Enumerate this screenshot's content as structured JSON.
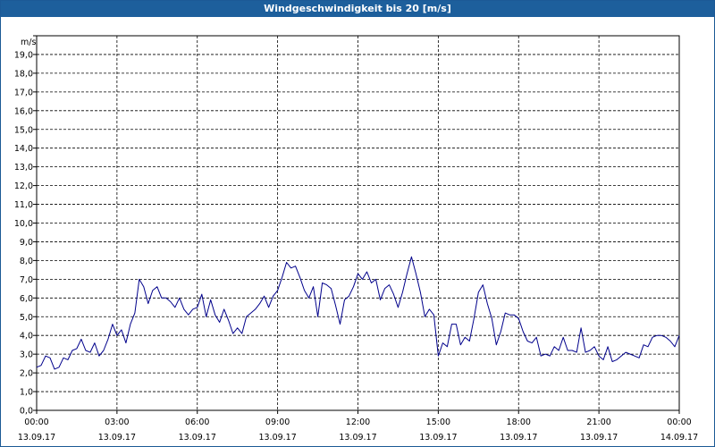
{
  "window": {
    "title": "Windgeschwindigkeit bis 20 [m/s]"
  },
  "colors": {
    "title_bar": "#1d5f9c",
    "series_line": "#00008b",
    "grid": "#000000"
  },
  "chart_data": {
    "type": "line",
    "title": "Windgeschwindigkeit bis 20 [m/s]",
    "ylabel": "m/s",
    "xlabel": "",
    "ylim": [
      0,
      20
    ],
    "xlim": [
      0,
      24
    ],
    "y_ticks": [
      "0,0",
      "1,0",
      "2,0",
      "3,0",
      "4,0",
      "5,0",
      "6,0",
      "7,0",
      "8,0",
      "9,0",
      "10,0",
      "11,0",
      "12,0",
      "13,0",
      "14,0",
      "15,0",
      "16,0",
      "17,0",
      "18,0",
      "19,0"
    ],
    "x_ticks": [
      {
        "time": "00:00",
        "date": "13.09.17"
      },
      {
        "time": "03:00",
        "date": "13.09.17"
      },
      {
        "time": "06:00",
        "date": "13.09.17"
      },
      {
        "time": "09:00",
        "date": "13.09.17"
      },
      {
        "time": "12:00",
        "date": "13.09.17"
      },
      {
        "time": "15:00",
        "date": "13.09.17"
      },
      {
        "time": "18:00",
        "date": "13.09.17"
      },
      {
        "time": "21:00",
        "date": "13.09.17"
      },
      {
        "time": "00:00",
        "date": "14.09.17"
      }
    ],
    "grid": true,
    "series": [
      {
        "x": [
          0,
          0.167,
          0.333,
          0.5,
          0.667,
          0.833,
          1,
          1.167,
          1.333,
          1.5,
          1.667,
          1.833,
          2,
          2.167,
          2.333,
          2.5,
          2.667,
          2.833,
          3,
          3.167,
          3.333,
          3.5,
          3.667,
          3.833,
          4,
          4.167,
          4.333,
          4.5,
          4.667,
          4.833,
          5,
          5.167,
          5.333,
          5.5,
          5.667,
          5.833,
          6,
          6.167,
          6.333,
          6.5,
          6.667,
          6.833,
          7,
          7.167,
          7.333,
          7.5,
          7.667,
          7.833,
          8,
          8.167,
          8.333,
          8.5,
          8.667,
          8.833,
          9,
          9.167,
          9.333,
          9.5,
          9.667,
          9.833,
          10,
          10.167,
          10.333,
          10.5,
          10.667,
          10.833,
          11,
          11.167,
          11.333,
          11.5,
          11.667,
          11.833,
          12,
          12.167,
          12.333,
          12.5,
          12.667,
          12.833,
          13,
          13.167,
          13.333,
          13.5,
          13.667,
          13.833,
          14,
          14.167,
          14.333,
          14.5,
          14.667,
          14.833,
          15,
          15.167,
          15.333,
          15.5,
          15.667,
          15.833,
          16,
          16.167,
          16.333,
          16.5,
          16.667,
          16.833,
          17,
          17.167,
          17.333,
          17.5,
          17.667,
          17.833,
          18,
          18.167,
          18.333,
          18.5,
          18.667,
          18.833,
          19,
          19.167,
          19.333,
          19.5,
          19.667,
          19.833,
          20,
          20.167,
          20.333,
          20.5,
          20.667,
          20.833,
          21,
          21.167,
          21.333,
          21.5,
          21.667,
          21.833,
          22,
          22.167,
          22.333,
          22.5,
          22.667,
          22.833,
          23,
          23.167,
          23.333,
          23.5,
          23.667,
          23.833,
          24
        ],
        "values": [
          2.3,
          2.4,
          2.9,
          2.8,
          2.2,
          2.3,
          2.8,
          2.7,
          3.2,
          3.3,
          3.8,
          3.2,
          3.1,
          3.6,
          2.9,
          3.2,
          3.8,
          4.6,
          4.0,
          4.3,
          3.6,
          4.6,
          5.2,
          7.0,
          6.6,
          5.7,
          6.4,
          6.6,
          6.0,
          6.0,
          5.8,
          5.5,
          6.0,
          5.4,
          5.1,
          5.4,
          5.5,
          6.2,
          5.0,
          5.9,
          5.1,
          4.7,
          5.4,
          4.8,
          4.1,
          4.4,
          4.1,
          5.0,
          5.2,
          5.4,
          5.7,
          6.1,
          5.5,
          6.1,
          6.4,
          7.1,
          7.9,
          7.6,
          7.7,
          7.1,
          6.4,
          6.0,
          6.6,
          5.0,
          6.8,
          6.7,
          6.5,
          5.6,
          4.6,
          5.9,
          6.1,
          6.6,
          7.3,
          7.0,
          7.4,
          6.8,
          7.0,
          5.9,
          6.5,
          6.7,
          6.2,
          5.5,
          6.3,
          7.3,
          8.2,
          7.3,
          6.3,
          5.0,
          5.4,
          5.1,
          2.9,
          3.6,
          3.4,
          4.6,
          4.6,
          3.5,
          3.9,
          3.7,
          4.9,
          6.3,
          6.7,
          5.7,
          4.9,
          3.5,
          4.2,
          5.2,
          5.1,
          5.1,
          4.9,
          4.2,
          3.7,
          3.6,
          3.9,
          2.9,
          3.0,
          2.9,
          3.4,
          3.2,
          3.9,
          3.2,
          3.2,
          3.1,
          4.4,
          3.1,
          3.2,
          3.4,
          2.9,
          2.7,
          3.4,
          2.6,
          2.7,
          2.9,
          3.1,
          3.0,
          2.9,
          2.8,
          3.5,
          3.4,
          3.9,
          4.0,
          4.0,
          3.9,
          3.7,
          3.4,
          4.0
        ]
      }
    ]
  }
}
